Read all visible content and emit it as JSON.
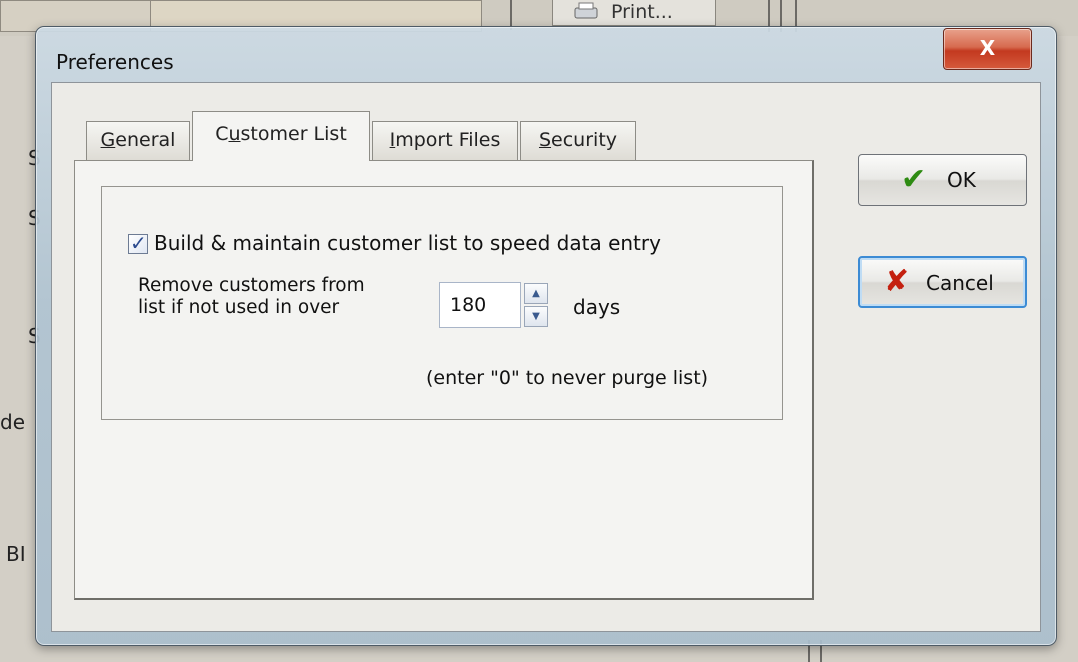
{
  "background": {
    "print_label": "Print...",
    "left_fragments": [
      "S",
      "S",
      "S",
      "de",
      "BI"
    ]
  },
  "dialog": {
    "title": "Preferences",
    "close_label": "X",
    "tabs": [
      {
        "label": "General",
        "accel": "G",
        "rest": "eneral",
        "active": false
      },
      {
        "label": "Customer List",
        "pre": "C",
        "accel": "u",
        "rest": "stomer List",
        "active": true
      },
      {
        "label": "Import Files",
        "accel": "I",
        "rest": "mport Files",
        "active": false
      },
      {
        "label": "Security",
        "accel": "S",
        "rest": "ecurity",
        "active": false
      }
    ],
    "customer_list": {
      "build_checkbox_label": "Build & maintain customer list to speed data entry",
      "build_checked": true,
      "remove_label_line1": "Remove customers from",
      "remove_label_line2": "list if not used in over",
      "days_value": "180",
      "days_unit": "days",
      "hint": "(enter \"0\" to never purge list)"
    },
    "buttons": {
      "ok_label": "OK",
      "cancel_label": "Cancel"
    },
    "colors": {
      "ok_icon": "#2e8b12",
      "cancel_icon": "#c4200f",
      "focus_border": "#3c8bd4"
    }
  }
}
